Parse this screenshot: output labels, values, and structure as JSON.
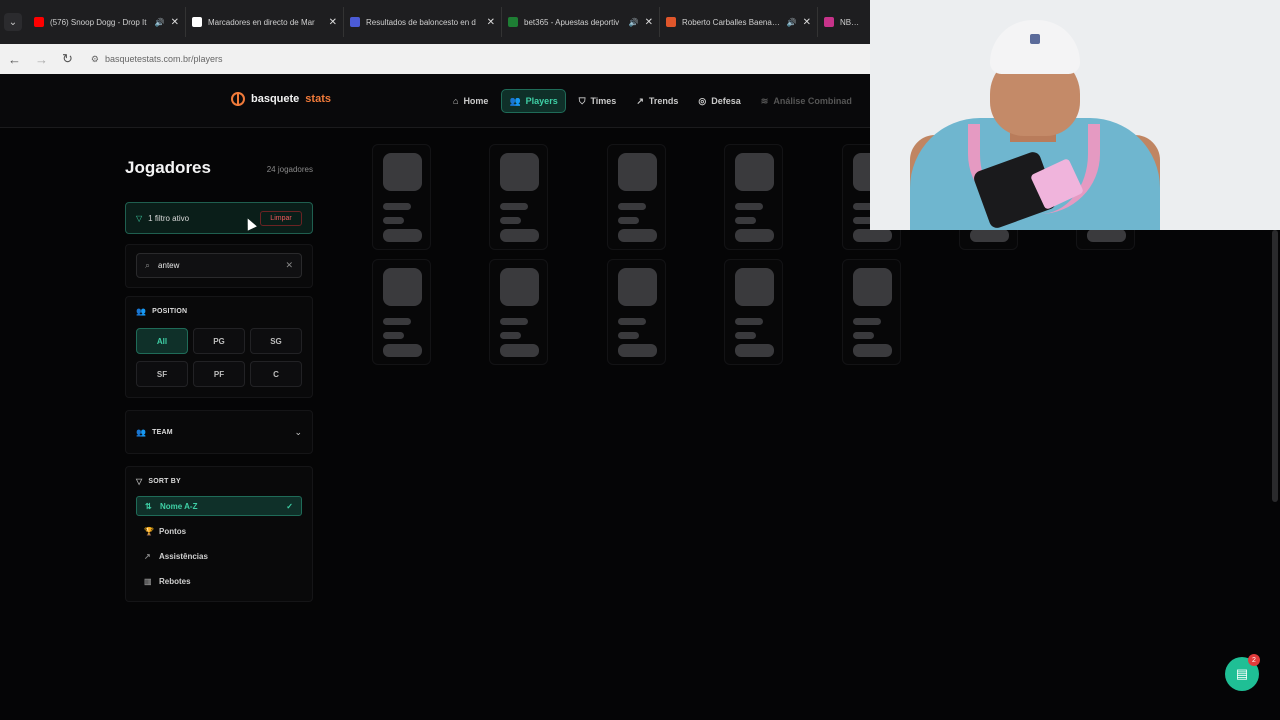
{
  "browser": {
    "tabs": [
      {
        "title": "(576) Snoop Dogg - Drop It",
        "favicon_color": "#ff0000",
        "has_audio": true
      },
      {
        "title": "Marcadores en directo de Mar",
        "favicon_color": "#ffffff",
        "has_audio": false
      },
      {
        "title": "Resultados de baloncesto en d",
        "favicon_color": "#4b5bd6",
        "has_audio": false
      },
      {
        "title": "bet365 - Apuestas deportiv",
        "favicon_color": "#1e7e34",
        "has_audio": true
      },
      {
        "title": "Roberto Carballes Baena - C",
        "favicon_color": "#e0562b",
        "has_audio": true
      },
      {
        "title": "NBA Stat",
        "favicon_color": "#c7338a",
        "has_audio": false
      }
    ],
    "url": "basquetestats.com.br/players"
  },
  "nav": {
    "brand_main": "basquete",
    "brand_accent": "stats",
    "links": [
      {
        "label": "Home",
        "icon": "home-icon",
        "active": false
      },
      {
        "label": "Players",
        "icon": "users-icon",
        "active": true
      },
      {
        "label": "Times",
        "icon": "shield-icon",
        "active": false
      },
      {
        "label": "Trends",
        "icon": "trend-icon",
        "active": false
      },
      {
        "label": "Defesa",
        "icon": "target-icon",
        "active": false
      },
      {
        "label": "Análise Combinad",
        "icon": "layers-icon",
        "active": false
      }
    ]
  },
  "sidebar": {
    "title": "Jogadores",
    "count": "24 jogadores",
    "filter_active": "1 filtro ativo",
    "clear_label": "Limpar",
    "search_value": "antew",
    "position_header": "POSITION",
    "positions": [
      "All",
      "PG",
      "SG",
      "SF",
      "PF",
      "C"
    ],
    "active_position": "All",
    "team_header": "TEAM",
    "sort_header": "SORT BY",
    "sort_options": [
      {
        "label": "Nome A-Z",
        "icon": "sort-alpha-icon",
        "active": true
      },
      {
        "label": "Pontos",
        "icon": "trophy-icon",
        "active": false
      },
      {
        "label": "Assistências",
        "icon": "trend-icon",
        "active": false
      },
      {
        "label": "Rebotes",
        "icon": "bar-chart-icon",
        "active": false
      }
    ]
  },
  "chat": {
    "badge": "2"
  },
  "colors": {
    "accent": "#3fd0a6",
    "brand": "#f07a3a",
    "danger": "#ef5b5b"
  }
}
